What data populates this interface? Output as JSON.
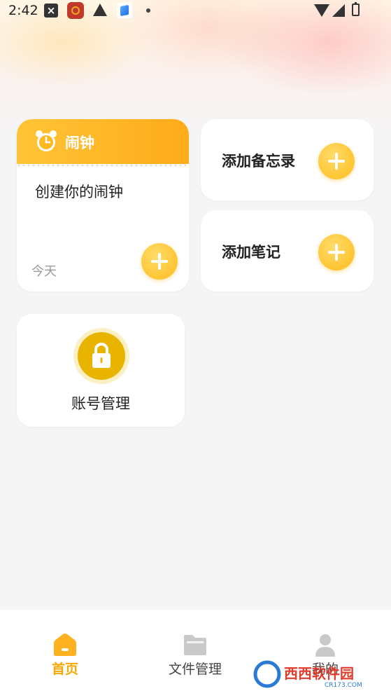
{
  "status_bar": {
    "time": "2:42",
    "icons": [
      "close-box-icon",
      "app-notification-icon",
      "warning-icon",
      "layers-icon",
      "dot-icon",
      "wifi-icon",
      "signal-icon",
      "battery-icon"
    ]
  },
  "alarm_card": {
    "title": "闹钟",
    "create_text": "创建你的闹钟",
    "date": "今天",
    "icon": "alarm-clock-icon"
  },
  "memo_card": {
    "label": "添加备忘录"
  },
  "note_card": {
    "label": "添加笔记"
  },
  "account_card": {
    "label": "账号管理",
    "icon": "lock-icon"
  },
  "tabbar": {
    "active": "home",
    "tabs": [
      {
        "id": "home",
        "label": "首页",
        "icon": "home-icon"
      },
      {
        "id": "files",
        "label": "文件管理",
        "icon": "folder-icon"
      },
      {
        "id": "mine",
        "label": "我的",
        "icon": "user-icon"
      }
    ]
  },
  "watermark": {
    "brand": "西西软件园",
    "site": "CR173.COM"
  },
  "colors": {
    "accent": "#ffb11f",
    "background": "#f5f5f5",
    "tab_active": "#f7a800"
  }
}
